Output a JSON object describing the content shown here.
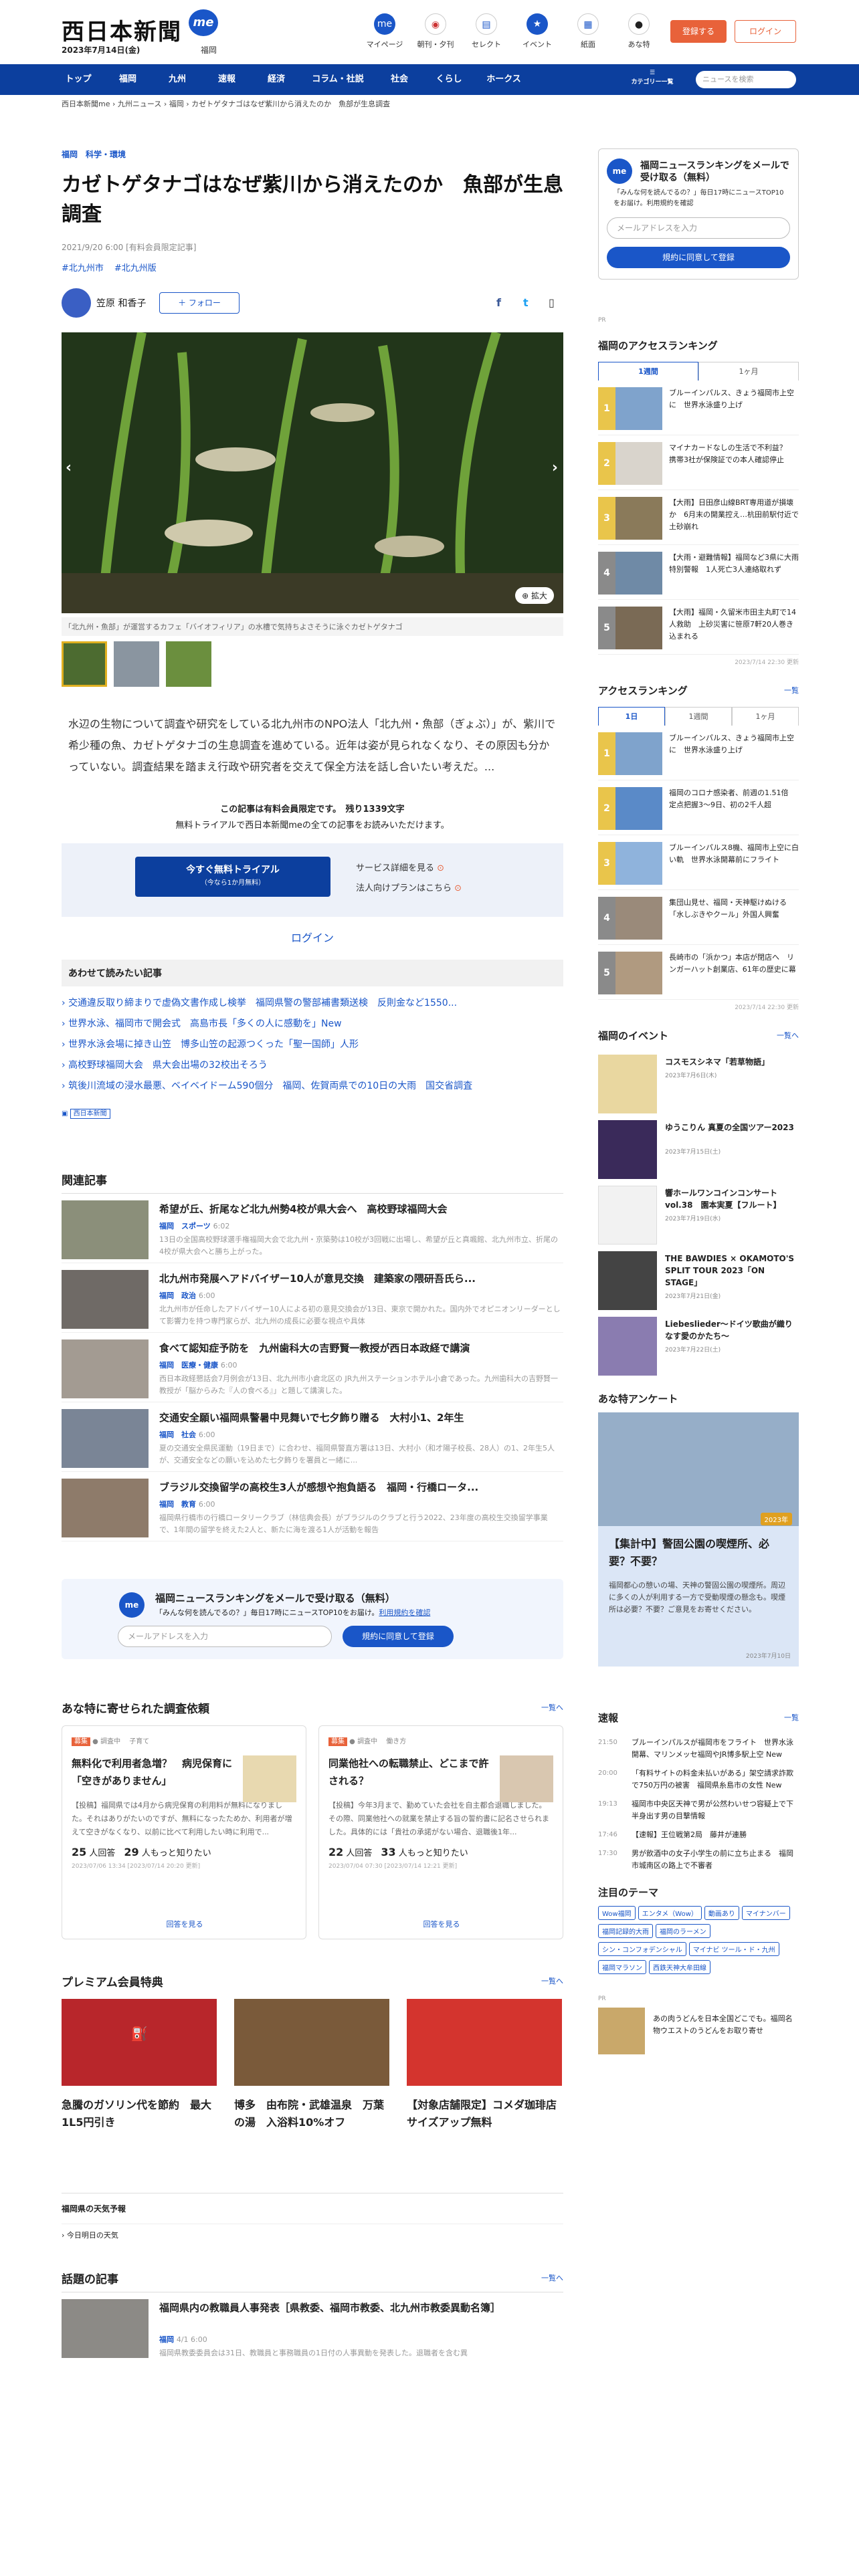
{
  "header": {
    "logo": "西日本新聞",
    "me": "me",
    "date": "2023年7月14日(金)",
    "city": "福岡",
    "icons": [
      "マイページ",
      "朝刊・夕刊",
      "セレクト",
      "イベント",
      "紙面",
      "あな特"
    ],
    "register": "登録する",
    "login": "ログイン"
  },
  "nav": {
    "items": [
      "トップ",
      "福岡",
      "九州",
      "速報",
      "経済",
      "コラム・社説",
      "社会",
      "くらし",
      "ホークス"
    ],
    "menu": "カテゴリー一覧",
    "search_placeholder": "ニュースを検索"
  },
  "breadcrumb": "西日本新聞me  ›  九州ニュース  ›  福岡  ›  カゼトゲタナゴはなぜ紫川から消えたのか　魚部が生息調査",
  "article": {
    "category": "福岡　科学・環境",
    "title": "カゼトゲタナゴはなぜ紫川から消えたのか　魚部が生息調査",
    "meta": "2021/9/20 6:00 [有料会員限定記事]",
    "tags": [
      "#北九州市",
      "#北九州版"
    ],
    "author": "笠原 和香子",
    "follow": "＋ フォロー",
    "enlarge": "拡大",
    "caption": "「北九州・魚部」が運営するカフェ「バイオフィリア」の水槽で気持ちよさそうに泳ぐカゼトゲタナゴ",
    "lead": "水辺の生物について調査や研究をしている北九州市のNPO法人「北九州・魚部（ぎょぶ）」が、紫川で希少種の魚、カゼトゲタナゴの生息調査を進めている。近年は姿が見られなくなり、その原因も分かっていない。調査結果を踏まえ行政や研究者を交えて保全方法を話し合いたい考えだ。...",
    "paid": "この記事は有料会員限定です。　残り1339文字",
    "paid2": "無料トライアルで西日本新聞meの全ての記事をお読みいただけます。",
    "trial_btn": "今すぐ無料トライアル",
    "trial_sub": "（今なら1か月無料）",
    "service_link": "サービス詳細を見る",
    "corp_link": "法人向けプランはこちら",
    "login": "ログイン"
  },
  "also": {
    "title": "あわせて読みたい記事",
    "items": [
      "交通違反取り締まりで虚偽文書作成し検挙　福岡県警の警部補書類送検　反則金など1550...",
      "世界水泳、福岡市で開会式　高島市長「多くの人に感動を」New",
      "世界水泳会場に掉き山笠　博多山笠の起源つくった「聖一国師」人形",
      "高校野球福岡大会　県大会出場の32校出そろう",
      "筑後川流域の浸水最悪、ベイベイドーム590個分　福岡、佐賀両県での10日の大雨　国交省調査"
    ],
    "logo": "西日本新聞"
  },
  "related": {
    "title": "関連記事",
    "items": [
      {
        "t": "希望が丘、折尾など北九州勢4校が県大会へ　高校野球福岡大会",
        "c": "福岡　スポーツ",
        "tm": "6:02",
        "d": "13日の全国高校野球選手権福岡大会で北九州・京築勢は10校が3回戦に出場し、希望が丘と真颯館、北九州市立、折尾の4校が県大会へと勝ち上がった。"
      },
      {
        "t": "北九州市発展へアドバイザー10人が意見交換　建築家の隈研吾氏ら...",
        "c": "福岡　政治",
        "tm": "6:00",
        "d": "北九州市が任命したアドバイザー10人による初の意見交換会が13日、東京で開かれた。国内外でオピニオンリーダーとして影響力を持つ専門家らが、北九州の成長に必要な視点や具体"
      },
      {
        "t": "食べて認知症予防を　九州歯科大の吉野賢一教授が西日本政経で講演",
        "c": "福岡　医療・健康",
        "tm": "6:00",
        "d": "西日本政経懇話会7月例会が13日、北九州市小倉北区の JR九州ステーションホテル小倉であった。九州歯科大の吉野賢一教授が「脳からみた『人の食べる』」と題して講演した。"
      },
      {
        "t": "交通安全願い福岡県警暑中見舞いで七夕飾り贈る　大村小1、2年生",
        "c": "福岡　社会",
        "tm": "6:00",
        "d": "夏の交通安全県民運動（19日まで）に合わせ、福岡県警直方署は13日、大村小（和才陽子校長、28人）の1、2年生5人が、交通安全などの願いを込めた七夕飾りを署員と一緒に..."
      },
      {
        "t": "ブラジル交換留学の高校生3人が感想や抱負語る　福岡・行橋ロータ...",
        "c": "福岡　教育",
        "tm": "6:00",
        "d": "福岡県行橋市の行橋ロータリークラブ（林信典会長）がブラジルのクラブと行う2022、23年度の高校生交換留学事業で、1年間の留学を終えた2人と、新たに海を渡る1人が活動を報告"
      }
    ]
  },
  "mail": {
    "title": "福岡ニュースランキングをメールで受け取る（無料）",
    "desc": "「みんな何を読んでるの？」毎日17時にニュースTOP10をお届け。",
    "terms": "利用規約を確認",
    "placeholder": "メールアドレスを入力",
    "button": "規約に同意して登録"
  },
  "survey": {
    "title": "あな特に寄せられた調査依頼",
    "more": "一覧へ",
    "items": [
      {
        "tag": "子育て",
        "t": "無料化で利用者急増？　病児保育に「空きがありません」",
        "d": "【投稿】福岡県では4月から病児保育の利用料が無料になりました。それはありがたいのですが、無料になったためか、利用者が増えて空きがなくなり、以前に比べて利用したい時に利用で...",
        "c1": "25",
        "c2": "29",
        "date": "2023/07/06 13:34 [2023/07/14 20:20 更新]",
        "link": "回答を見る"
      },
      {
        "tag": "働き方",
        "t": "同業他社への転職禁止、どこまで許される？",
        "d": "【投稿】今年3月まで、勤めていた会社を自主都合退職しました。その際、同業他社への就業を禁止する旨の誓約書に記名させられました。具体的には「貴社の承諾がない場合、退職後1年...",
        "c1": "22",
        "c2": "33",
        "date": "2023/07/04 07:30 [2023/07/14 12:21 更新]",
        "link": "回答を見る"
      }
    ]
  },
  "premium": {
    "title": "プレミアム会員特典",
    "more": "一覧へ",
    "items": [
      "急騰のガソリン代を節約　最大1L5円引き",
      "博多　由布院・武雄温泉　万葉の湯　入浴料10%オフ",
      "【対象店舗限定】コメダ珈琲店 サイズアップ無料"
    ]
  },
  "weather": {
    "title": "福岡県の天気予報",
    "link": "今日明日の天気"
  },
  "topic": {
    "title": "話題の記事",
    "more": "一覧へ",
    "t": "福岡県内の教職員人事発表［県教委、福岡市教委、北九州市教委異動名簿］",
    "c": "福岡",
    "tm": "4/1 6:00",
    "d": "福岡県教委委員会は31日、教職員と事務職員の1日付の人事異動を発表した。退職者を含む異"
  },
  "side": {
    "mail_title": "福岡ニュースランキングをメールで受け取る（無料）",
    "mail_desc": "「みんな何を読んでるの？」毎日17時にニュースTOP10をお届け。利用規約を確認",
    "mail_placeholder": "メールアドレスを入力",
    "mail_button": "規約に同意して登録",
    "ad": "PR",
    "rank_title": "福岡のアクセスランキング",
    "rank_tabs": [
      "1週間",
      "1ヶ月"
    ],
    "rank": [
      "ブルーインパルス、きょう福岡市上空に　世界水泳盛り上げ",
      "マイナカードなしの生活で不利益？　携帯3社が保険証での本人確認停止",
      "【大雨】日田彦山線BRT専用道が損壊か　6月末の開業控え…杭田前駅付近で土砂崩れ",
      "【大雨・避難情報】福岡など3県に大雨特別警報　1人死亡3人連絡取れず",
      "【大雨】福岡・久留米市田主丸町で14人救助　上砂災害に笹原7軒20人巻き込まれる"
    ],
    "rank_stamp": "2023/7/14 22:30 更新",
    "access_title": "アクセスランキング",
    "access_more": "一覧",
    "access_tabs": [
      "1日",
      "1週間",
      "1ヶ月"
    ],
    "access": [
      "ブルーインパルス、きょう福岡市上空に　世界水泳盛り上げ",
      "福岡のコロナ感染者、前週の1.51倍　定点把握3〜9日、初の2千人超",
      "ブルーインパルス8機、福岡市上空に白い軌　世界水泳開幕前にフライト",
      "集団山見せ、福岡・天神駆けぬける「水しぶきやクール」外国人興奮",
      "長崎市の「浜かつ」本店が閉店へ　リンガーハット創業店、61年の歴史に幕"
    ],
    "access_stamp": "2023/7/14 22:30 更新",
    "event_title": "福岡のイベント",
    "event_more": "一覧へ",
    "events": [
      {
        "t": "コスモスシネマ「若草物語」",
        "tag": "2023年7月6日(木)"
      },
      {
        "t": "ゆうこりん 真夏の全国ツアー2023",
        "tag": "2023年7月15日(土)"
      },
      {
        "t": "響ホールワンコインコンサートvol.38　園本実夏【フルート】",
        "tag": "2023年7月19日(水)"
      },
      {
        "t": "THE BAWDIES × OKAMOTO'S SPLIT TOUR 2023「ON STAGE」",
        "tag": "2023年7月21日(金)"
      },
      {
        "t": "Liebeslieder〜ドイツ歌曲が織りなす愛のかたち〜",
        "tag": "2023年7月22日(土)"
      }
    ],
    "q_title": "あな特アンケート",
    "q_t": "【集計中】警固公園の喫煙所、必要？不要？",
    "q_d": "福岡都心の憩いの場、天神の警固公園の喫煙所。周辺に多くの人が利用する一方で受動喫煙の懸念も。喫煙所は必要？不要？ご意見をお寄せください。",
    "q_date": "2023年7月10日",
    "q_badge": "2023年",
    "news_title": "速報",
    "news_more": "一覧",
    "news": [
      {
        "tm": "21:50",
        "t": "ブルーインパルスが福岡市をフライト　世界水泳開幕、マリンメッセ福岡やJR博多駅上空 New"
      },
      {
        "tm": "20:00",
        "t": "「有料サイトの料金未払いがある」架空請求詐欺で750万円の被害　福岡県糸島市の女性 New"
      },
      {
        "tm": "19:13",
        "t": "福岡市中央区天神で男が公然わいせつ容疑上で下半身出す男の目撃情報"
      },
      {
        "tm": "17:46",
        "t": "【速報】王位戦第2局　藤井が連勝"
      },
      {
        "tm": "17:30",
        "t": "男が飲酒中の女子小学生の前に立ち止まる　福岡市城南区の路上で不審者"
      }
    ],
    "theme_title": "注目のテーマ",
    "themes": [
      "Wow福岡",
      "エンタメ（Wow）",
      "動画あり",
      "マイナンバー",
      "福岡記録的大雨",
      "福岡のラーメン",
      "シン・コンフォデンシャル",
      "マイナビ ツール・ド・九州",
      "福岡マラソン",
      "西鉄天神大牟田線"
    ],
    "pr": "PR",
    "pr_text": "あの肉うどんを日本全国どこでも。福岡名物ウエストのうどんをお取り寄せ"
  }
}
